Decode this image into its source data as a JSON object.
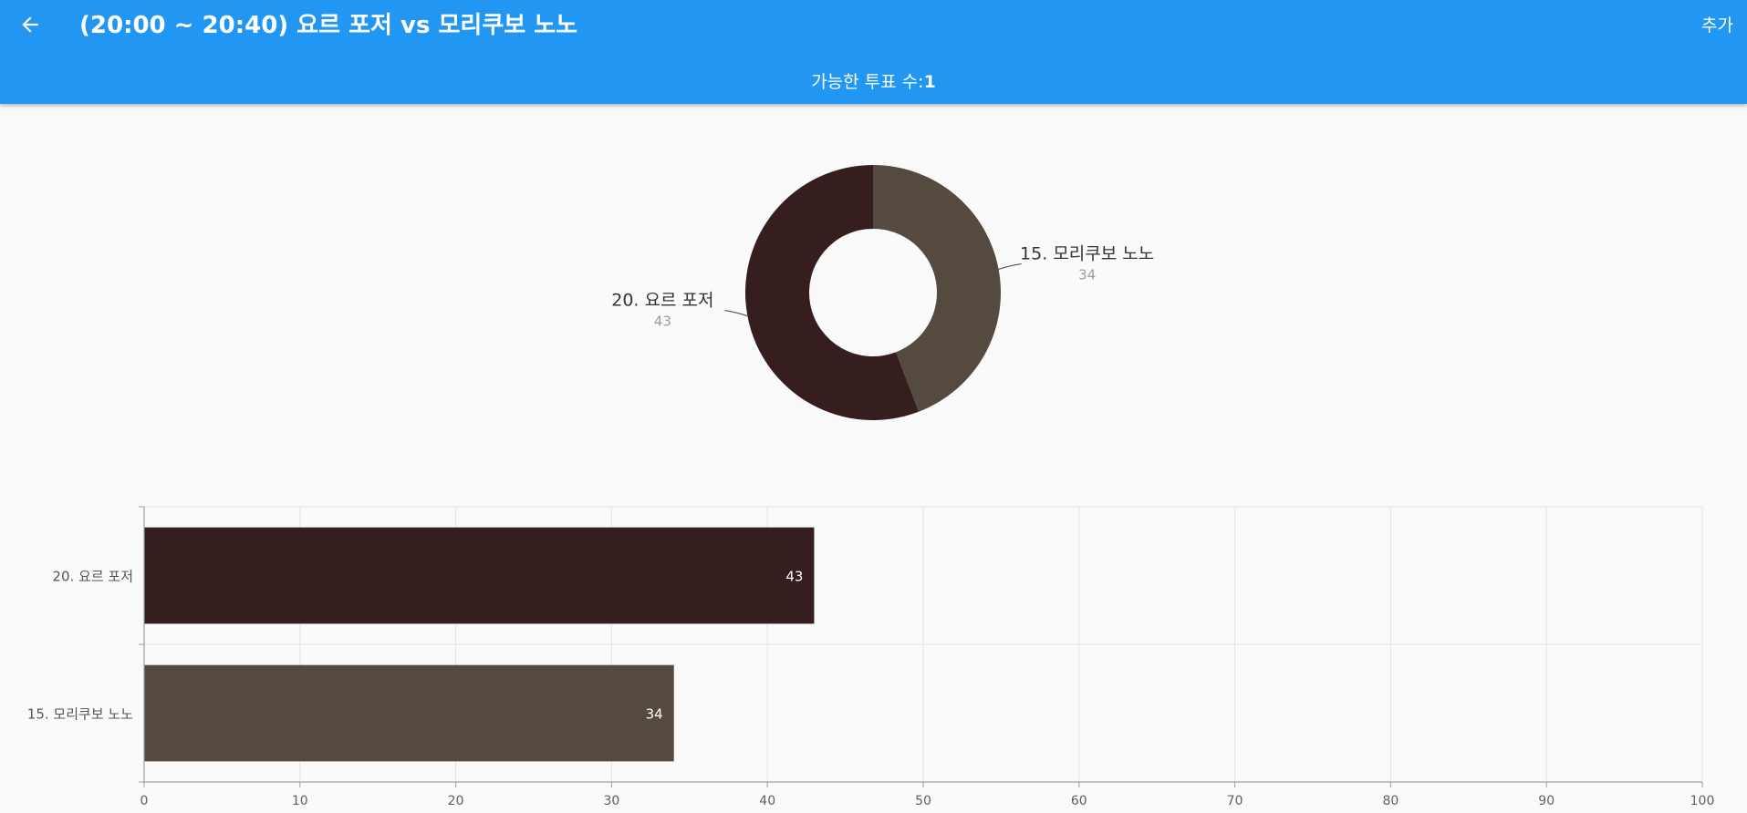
{
  "app_bar": {
    "title": "(20:00 ~ 20:40) 요르 포저 vs 모리쿠보 노노",
    "action_label": "추가",
    "subtitle_label": "가능한 투표 수:",
    "subtitle_value": "1"
  },
  "icons": {
    "back": "arrow-left-icon"
  },
  "colors": {
    "app_bar": "#2196f3",
    "series_a": "#361e1f",
    "series_b": "#554a3f"
  },
  "chart_data": [
    {
      "type": "pie",
      "donut": true,
      "labels": [
        "20. 요르 포저",
        "15. 모리쿠보 노노"
      ],
      "values": [
        43,
        34
      ]
    },
    {
      "type": "bar",
      "orientation": "horizontal",
      "categories": [
        "20. 요르 포저",
        "15. 모리쿠보 노노"
      ],
      "values": [
        43,
        34
      ],
      "xlim": [
        0,
        100
      ],
      "xticks": [
        0,
        10,
        20,
        30,
        40,
        50,
        60,
        70,
        80,
        90,
        100
      ],
      "grid": true
    }
  ]
}
